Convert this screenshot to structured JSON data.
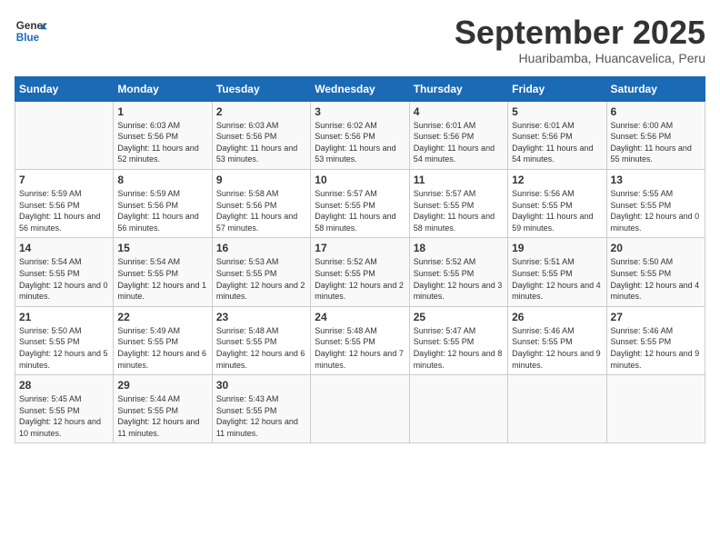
{
  "logo": {
    "line1": "General",
    "line2": "Blue"
  },
  "title": "September 2025",
  "subtitle": "Huaribamba, Huancavelica, Peru",
  "days_of_week": [
    "Sunday",
    "Monday",
    "Tuesday",
    "Wednesday",
    "Thursday",
    "Friday",
    "Saturday"
  ],
  "weeks": [
    [
      {
        "day": "",
        "empty": true
      },
      {
        "day": "1",
        "sunrise": "6:03 AM",
        "sunset": "5:56 PM",
        "daylight": "11 hours and 52 minutes."
      },
      {
        "day": "2",
        "sunrise": "6:03 AM",
        "sunset": "5:56 PM",
        "daylight": "11 hours and 53 minutes."
      },
      {
        "day": "3",
        "sunrise": "6:02 AM",
        "sunset": "5:56 PM",
        "daylight": "11 hours and 53 minutes."
      },
      {
        "day": "4",
        "sunrise": "6:01 AM",
        "sunset": "5:56 PM",
        "daylight": "11 hours and 54 minutes."
      },
      {
        "day": "5",
        "sunrise": "6:01 AM",
        "sunset": "5:56 PM",
        "daylight": "11 hours and 54 minutes."
      },
      {
        "day": "6",
        "sunrise": "6:00 AM",
        "sunset": "5:56 PM",
        "daylight": "11 hours and 55 minutes."
      }
    ],
    [
      {
        "day": "7",
        "sunrise": "5:59 AM",
        "sunset": "5:56 PM",
        "daylight": "11 hours and 56 minutes."
      },
      {
        "day": "8",
        "sunrise": "5:59 AM",
        "sunset": "5:56 PM",
        "daylight": "11 hours and 56 minutes."
      },
      {
        "day": "9",
        "sunrise": "5:58 AM",
        "sunset": "5:56 PM",
        "daylight": "11 hours and 57 minutes."
      },
      {
        "day": "10",
        "sunrise": "5:57 AM",
        "sunset": "5:55 PM",
        "daylight": "11 hours and 58 minutes."
      },
      {
        "day": "11",
        "sunrise": "5:57 AM",
        "sunset": "5:55 PM",
        "daylight": "11 hours and 58 minutes."
      },
      {
        "day": "12",
        "sunrise": "5:56 AM",
        "sunset": "5:55 PM",
        "daylight": "11 hours and 59 minutes."
      },
      {
        "day": "13",
        "sunrise": "5:55 AM",
        "sunset": "5:55 PM",
        "daylight": "12 hours and 0 minutes."
      }
    ],
    [
      {
        "day": "14",
        "sunrise": "5:54 AM",
        "sunset": "5:55 PM",
        "daylight": "12 hours and 0 minutes."
      },
      {
        "day": "15",
        "sunrise": "5:54 AM",
        "sunset": "5:55 PM",
        "daylight": "12 hours and 1 minute."
      },
      {
        "day": "16",
        "sunrise": "5:53 AM",
        "sunset": "5:55 PM",
        "daylight": "12 hours and 2 minutes."
      },
      {
        "day": "17",
        "sunrise": "5:52 AM",
        "sunset": "5:55 PM",
        "daylight": "12 hours and 2 minutes."
      },
      {
        "day": "18",
        "sunrise": "5:52 AM",
        "sunset": "5:55 PM",
        "daylight": "12 hours and 3 minutes."
      },
      {
        "day": "19",
        "sunrise": "5:51 AM",
        "sunset": "5:55 PM",
        "daylight": "12 hours and 4 minutes."
      },
      {
        "day": "20",
        "sunrise": "5:50 AM",
        "sunset": "5:55 PM",
        "daylight": "12 hours and 4 minutes."
      }
    ],
    [
      {
        "day": "21",
        "sunrise": "5:50 AM",
        "sunset": "5:55 PM",
        "daylight": "12 hours and 5 minutes."
      },
      {
        "day": "22",
        "sunrise": "5:49 AM",
        "sunset": "5:55 PM",
        "daylight": "12 hours and 6 minutes."
      },
      {
        "day": "23",
        "sunrise": "5:48 AM",
        "sunset": "5:55 PM",
        "daylight": "12 hours and 6 minutes."
      },
      {
        "day": "24",
        "sunrise": "5:48 AM",
        "sunset": "5:55 PM",
        "daylight": "12 hours and 7 minutes."
      },
      {
        "day": "25",
        "sunrise": "5:47 AM",
        "sunset": "5:55 PM",
        "daylight": "12 hours and 8 minutes."
      },
      {
        "day": "26",
        "sunrise": "5:46 AM",
        "sunset": "5:55 PM",
        "daylight": "12 hours and 9 minutes."
      },
      {
        "day": "27",
        "sunrise": "5:46 AM",
        "sunset": "5:55 PM",
        "daylight": "12 hours and 9 minutes."
      }
    ],
    [
      {
        "day": "28",
        "sunrise": "5:45 AM",
        "sunset": "5:55 PM",
        "daylight": "12 hours and 10 minutes."
      },
      {
        "day": "29",
        "sunrise": "5:44 AM",
        "sunset": "5:55 PM",
        "daylight": "12 hours and 11 minutes."
      },
      {
        "day": "30",
        "sunrise": "5:43 AM",
        "sunset": "5:55 PM",
        "daylight": "12 hours and 11 minutes."
      },
      {
        "day": "",
        "empty": true
      },
      {
        "day": "",
        "empty": true
      },
      {
        "day": "",
        "empty": true
      },
      {
        "day": "",
        "empty": true
      }
    ]
  ]
}
